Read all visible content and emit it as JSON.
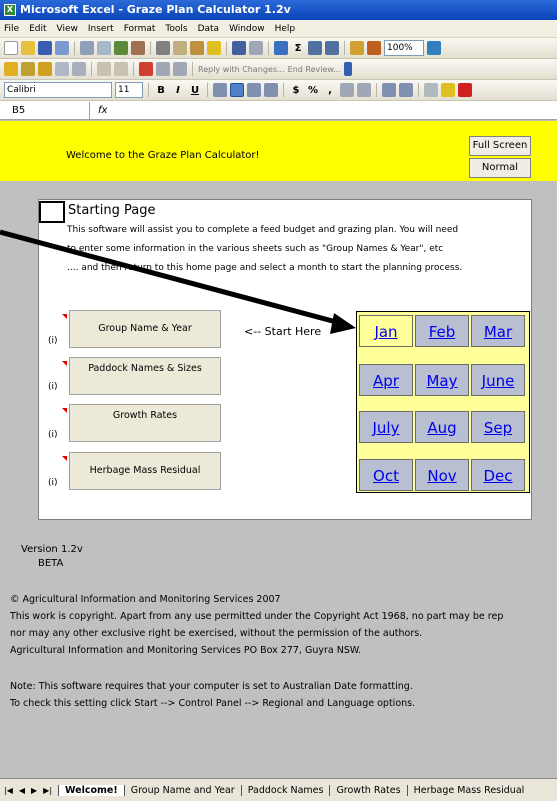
{
  "window": {
    "title": "Microsoft Excel - Graze Plan Calculator 1.2v"
  },
  "menu": [
    "File",
    "Edit",
    "View",
    "Insert",
    "Format",
    "Tools",
    "Data",
    "Window",
    "Help"
  ],
  "toolbar": {
    "zoom": "100%",
    "reply_text": "Reply with Changes...",
    "end_review": "End Review...",
    "font_name": "Calibri",
    "font_size": "11",
    "bold": "B",
    "italic": "I",
    "underline": "U",
    "currency": "$",
    "percent": "%",
    "comma": ","
  },
  "formula_bar": {
    "cell": "B5",
    "fx": "fx"
  },
  "header": {
    "welcome": "Welcome to the Graze Plan Calculator!",
    "full_screen": "Full Screen",
    "normal": "Normal"
  },
  "starting": {
    "title": "Starting Page",
    "line1": "This software will assist you to complete a feed budget and grazing plan.  You will need",
    "line2": "to enter some information in the various sheets such as \"Group Names & Year\", etc",
    "line3": ".... and then return to this home page and select a month to start the planning process."
  },
  "buttons": [
    {
      "label": "Group Name & Year",
      "info": "(i)"
    },
    {
      "label": "Paddock Names & Sizes",
      "info": "(i)"
    },
    {
      "label": "Growth Rates",
      "info": "(i)"
    },
    {
      "label": "Herbage Mass Residual",
      "info": "(i)"
    }
  ],
  "start_here": "<-- Start Here",
  "months": [
    "Jan",
    "Feb",
    "Mar",
    "Apr",
    "May",
    "June",
    "July",
    "Aug",
    "Sep",
    "Oct",
    "Nov",
    "Dec"
  ],
  "footer": {
    "version": "Version 1.2v",
    "beta": "BETA",
    "copyright": "© Agricultural Information and Monitoring Services  2007",
    "work1": "This work is copyright.  Apart from any use permitted under the Copyright Act 1968, no part may be rep",
    "work2": "nor may any other exclusive right be exercised, without the permission of the authors.",
    "work3": "Agricultural Information and Monitoring Services PO Box 277, Guyra NSW.",
    "note1": "Note: This software requires that your computer is set to Australian Date formatting.",
    "note2": "To check this setting click Start --> Control Panel --> Regional and Language options."
  },
  "sheet_tabs": [
    "Welcome!",
    "Group Name and Year",
    "Paddock Names",
    "Growth Rates",
    "Herbage Mass Residual"
  ]
}
